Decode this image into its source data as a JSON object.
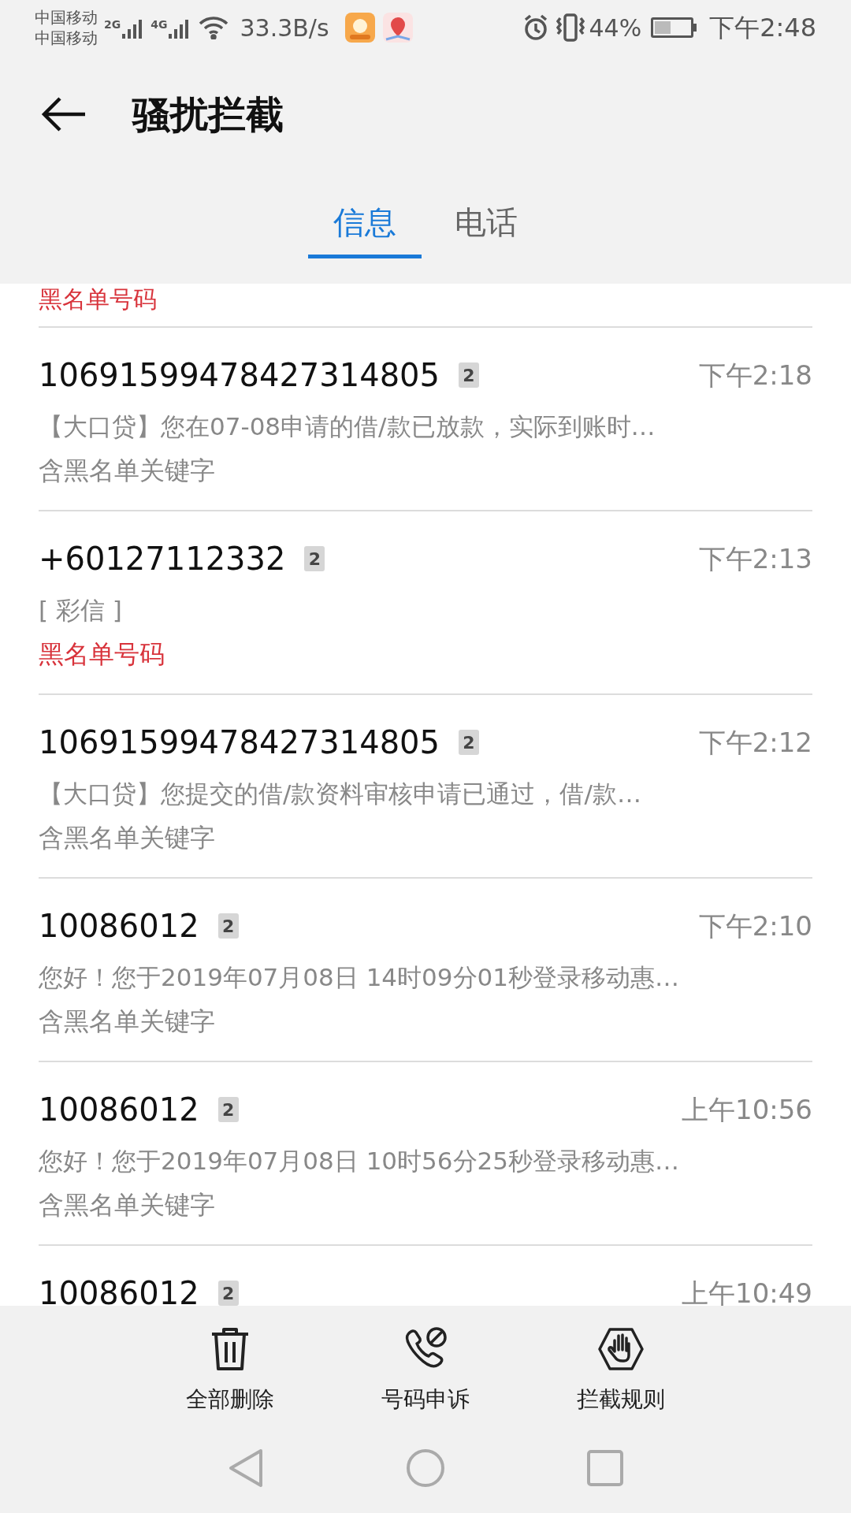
{
  "status_bar": {
    "carriers": [
      "中国移动",
      "中国移动"
    ],
    "networks": [
      "2G",
      "4G"
    ],
    "speed": "33.3B/s",
    "battery": "44%",
    "time": "下午2:48"
  },
  "header": {
    "title": "骚扰拦截",
    "tabs": [
      {
        "label": "信息",
        "selected": true
      },
      {
        "label": "电话",
        "selected": false
      }
    ]
  },
  "cut_off_item": {
    "tag": "黑名单号码",
    "color": "#d8333b"
  },
  "messages": [
    {
      "sender": "10691599478427314805",
      "sim": "2",
      "time": "下午2:18",
      "preview": "【大口贷】您在07-08申请的借/款已放款，实际到账时…",
      "tag": "含黑名单关键字",
      "color": "#888888"
    },
    {
      "sender": "+60127112332",
      "sim": "2",
      "time": "下午2:13",
      "preview": "[ 彩信 ]",
      "tag": "黑名单号码",
      "color": "#d8333b"
    },
    {
      "sender": "10691599478427314805",
      "sim": "2",
      "time": "下午2:12",
      "preview": "【大口贷】您提交的借/款资料审核申请已通过，借/款…",
      "tag": "含黑名单关键字",
      "color": "#888888"
    },
    {
      "sender": "10086012",
      "sim": "2",
      "time": "下午2:10",
      "preview": "您好！您于2019年07月08日 14时09分01秒登录移动惠…",
      "tag": "含黑名单关键字",
      "color": "#888888"
    },
    {
      "sender": "10086012",
      "sim": "2",
      "time": "上午10:56",
      "preview": "您好！您于2019年07月08日 10时56分25秒登录移动惠…",
      "tag": "含黑名单关键字",
      "color": "#888888"
    },
    {
      "sender": "10086012",
      "sim": "2",
      "time": "上午10:49"
    }
  ],
  "actions": [
    {
      "label": "全部删除",
      "kind": "delete"
    },
    {
      "label": "号码申诉",
      "kind": "appeal"
    },
    {
      "label": "拦截规则",
      "kind": "rules"
    }
  ]
}
